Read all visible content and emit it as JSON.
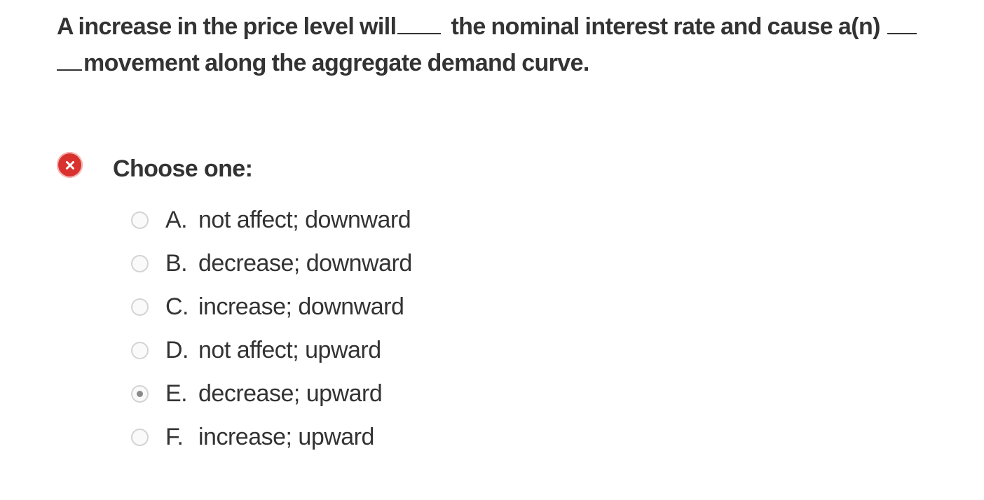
{
  "question": {
    "part1": "A increase in the price level will",
    "part2": "the nominal interest rate and cause a(n)",
    "part3": "movement along the aggregate demand curve."
  },
  "status": {
    "icon": "x-circle-icon",
    "color": "#d9322e"
  },
  "prompt": "Choose one:",
  "options": [
    {
      "letter": "A.",
      "text": "not affect; downward",
      "selected": false
    },
    {
      "letter": "B.",
      "text": "decrease; downward",
      "selected": false
    },
    {
      "letter": "C.",
      "text": "increase; downward",
      "selected": false
    },
    {
      "letter": "D.",
      "text": "not affect; upward",
      "selected": false
    },
    {
      "letter": "E.",
      "text": "decrease; upward",
      "selected": true
    },
    {
      "letter": "F.",
      "text": "increase; upward",
      "selected": false
    }
  ]
}
